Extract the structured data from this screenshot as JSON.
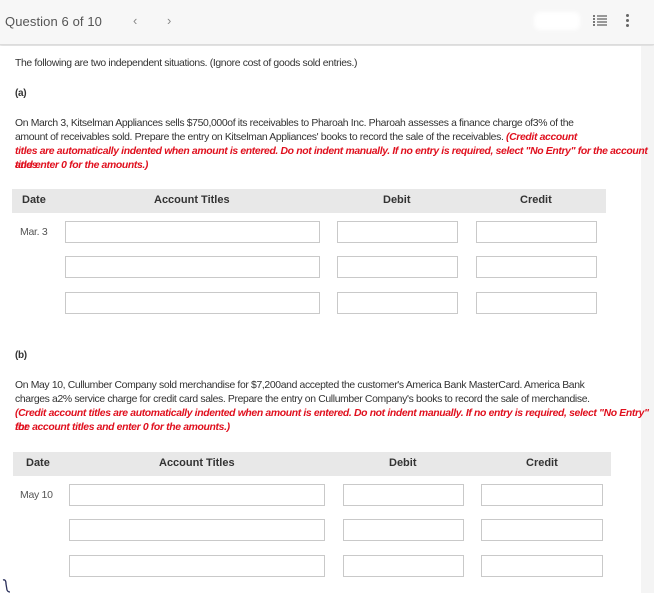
{
  "header": {
    "question_label": "Question 6 of 10",
    "prev_icon": "chevron-left-icon",
    "next_icon": "chevron-right-icon",
    "prev_glyph": "‹",
    "next_glyph": "›",
    "list_icon": "list-icon",
    "more_icon": "more-vertical-icon"
  },
  "intro": "The following are two independent situations. (Ignore cost of goods sold entries.)",
  "part_a": {
    "label": "(a)",
    "text_line1": "On March 3, Kitselman Appliances sells $750,000of its receivables to Pharoah Inc. Pharoah assesses a finance charge of3% of the",
    "text_line2_normal": "amount of receivables sold. Prepare the entry on Kitselman Appliances' books to record the sale of the receivables. ",
    "text_line2_red": "(Credit account",
    "text_line3_red": "titles are automatically indented when amount is entered. Do not indent manually. If no entry is required, select \"No Entry\" for the account titles",
    "text_line4_red": "and enter 0 for the amounts.)",
    "table": {
      "headers": {
        "date": "Date",
        "account": "Account Titles",
        "debit": "Debit",
        "credit": "Credit"
      },
      "date": "Mar. 3",
      "rows": [
        {
          "account": "",
          "debit": "",
          "credit": ""
        },
        {
          "account": "",
          "debit": "",
          "credit": ""
        },
        {
          "account": "",
          "debit": "",
          "credit": ""
        }
      ]
    }
  },
  "part_b": {
    "label": "(b)",
    "text_line1": "On May 10, Cullumber Company sold merchandise for $7,200and accepted the customer's America Bank MasterCard. America Bank",
    "text_line2": "charges a2% service charge for credit card sales. Prepare the entry on Cullumber Company's books to record the sale of merchandise.",
    "text_line3_red": "(Credit account titles are automatically indented when amount is entered. Do not indent manually. If no entry is required, select \"No Entry\" for",
    "text_line4_red": "the account titles and enter 0 for the amounts.)",
    "table": {
      "headers": {
        "date": "Date",
        "account": "Account Titles",
        "debit": "Debit",
        "credit": "Credit"
      },
      "date": "May 10",
      "rows": [
        {
          "account": "",
          "debit": "",
          "credit": ""
        },
        {
          "account": "",
          "debit": "",
          "credit": ""
        },
        {
          "account": "",
          "debit": "",
          "credit": ""
        }
      ]
    }
  }
}
